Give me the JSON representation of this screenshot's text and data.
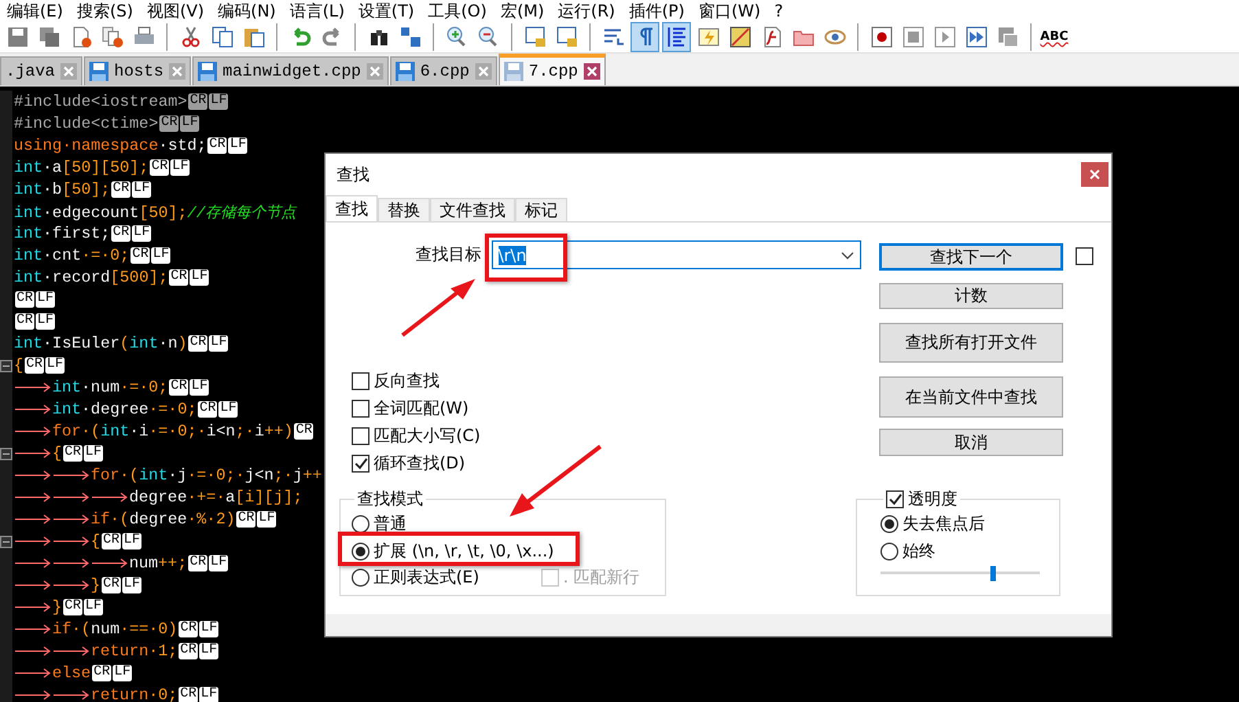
{
  "menu": [
    "编辑(E)",
    "搜索(S)",
    "视图(V)",
    "编码(N)",
    "语言(L)",
    "设置(T)",
    "工具(O)",
    "宏(M)",
    "运行(R)",
    "插件(P)",
    "窗口(W)",
    "?"
  ],
  "toolbar": {
    "buttons": [
      {
        "on": false
      },
      {
        "on": false
      },
      {
        "on": false
      },
      {
        "on": false
      },
      {
        "on": false
      },
      {
        "on": false
      },
      {
        "on": false
      },
      {
        "on": false
      },
      {
        "on": false
      },
      {
        "on": false
      },
      {
        "on": false
      },
      {
        "on": false
      },
      {
        "on": false
      },
      {
        "on": false
      },
      {
        "on": false
      },
      {
        "on": false
      },
      {
        "on": false
      },
      {
        "on": true
      },
      {
        "on": true
      },
      {
        "on": false
      },
      {
        "on": false
      },
      {
        "on": false
      },
      {
        "on": false
      },
      {
        "on": false
      },
      {
        "on": false
      },
      {
        "on": false
      },
      {
        "on": false
      },
      {
        "on": false
      },
      {
        "on": false
      }
    ],
    "spell_label": "ABC"
  },
  "tabs": [
    {
      "label": ".java",
      "icon": false,
      "selected": false
    },
    {
      "label": "hosts",
      "icon": true,
      "selected": false
    },
    {
      "label": "mainwidget.cpp",
      "icon": true,
      "selected": false
    },
    {
      "label": "6.cpp",
      "icon": true,
      "selected": false
    },
    {
      "label": "7.cpp",
      "icon": true,
      "selected": true
    }
  ],
  "editor": {
    "lines": [
      {
        "fold": false,
        "segs": [
          {
            "kind": "pre",
            "text": "#include<iostream>"
          },
          {
            "kind": "eoldim",
            "text": "CR"
          },
          {
            "kind": "eoldim",
            "text": "LF"
          }
        ]
      },
      {
        "fold": false,
        "segs": [
          {
            "kind": "pre",
            "text": "#include<ctime>"
          },
          {
            "kind": "eoldim",
            "text": "CR"
          },
          {
            "kind": "eoldim",
            "text": "LF"
          }
        ]
      },
      {
        "fold": false,
        "segs": [
          {
            "kind": "kw",
            "text": "using·namespace"
          },
          {
            "kind": "id",
            "text": "·std;"
          },
          {
            "kind": "eol",
            "text": "CR"
          },
          {
            "kind": "eol",
            "text": "LF"
          }
        ]
      },
      {
        "fold": false,
        "segs": [
          {
            "kind": "type",
            "text": "int"
          },
          {
            "kind": "id",
            "text": "·a"
          },
          {
            "kind": "op",
            "text": "[50][50];"
          },
          {
            "kind": "eol",
            "text": "CR"
          },
          {
            "kind": "eol",
            "text": "LF"
          }
        ]
      },
      {
        "fold": false,
        "segs": [
          {
            "kind": "type",
            "text": "int"
          },
          {
            "kind": "id",
            "text": "·b"
          },
          {
            "kind": "op",
            "text": "[50];"
          },
          {
            "kind": "eol",
            "text": "CR"
          },
          {
            "kind": "eol",
            "text": "LF"
          }
        ]
      },
      {
        "fold": false,
        "segs": [
          {
            "kind": "type",
            "text": "int"
          },
          {
            "kind": "id",
            "text": "·edgecount"
          },
          {
            "kind": "op",
            "text": "[50];"
          },
          {
            "kind": "cmt",
            "text": "//存储每个节点"
          }
        ]
      },
      {
        "fold": false,
        "segs": [
          {
            "kind": "type",
            "text": "int"
          },
          {
            "kind": "id",
            "text": "·first;"
          },
          {
            "kind": "eol",
            "text": "CR"
          },
          {
            "kind": "eol",
            "text": "LF"
          }
        ]
      },
      {
        "fold": false,
        "segs": [
          {
            "kind": "type",
            "text": "int"
          },
          {
            "kind": "id",
            "text": "·cnt"
          },
          {
            "kind": "op",
            "text": "·=·0;"
          },
          {
            "kind": "eol",
            "text": "CR"
          },
          {
            "kind": "eol",
            "text": "LF"
          }
        ]
      },
      {
        "fold": false,
        "segs": [
          {
            "kind": "type",
            "text": "int"
          },
          {
            "kind": "id",
            "text": "·record"
          },
          {
            "kind": "op",
            "text": "[500];"
          },
          {
            "kind": "eol",
            "text": "CR"
          },
          {
            "kind": "eol",
            "text": "LF"
          }
        ]
      },
      {
        "fold": false,
        "segs": [
          {
            "kind": "eol",
            "text": "CR"
          },
          {
            "kind": "eol",
            "text": "LF"
          }
        ]
      },
      {
        "fold": false,
        "segs": [
          {
            "kind": "eol",
            "text": "CR"
          },
          {
            "kind": "eol",
            "text": "LF"
          }
        ]
      },
      {
        "fold": false,
        "segs": [
          {
            "kind": "type",
            "text": "int"
          },
          {
            "kind": "id",
            "text": "·IsEuler"
          },
          {
            "kind": "op",
            "text": "("
          },
          {
            "kind": "type",
            "text": "int"
          },
          {
            "kind": "id",
            "text": "·n"
          },
          {
            "kind": "op",
            "text": ")"
          },
          {
            "kind": "eol",
            "text": "CR"
          },
          {
            "kind": "eol",
            "text": "LF"
          }
        ]
      },
      {
        "fold": true,
        "segs": [
          {
            "kind": "op",
            "text": "{"
          },
          {
            "kind": "eol",
            "text": "CR"
          },
          {
            "kind": "eol",
            "text": "LF"
          }
        ]
      },
      {
        "fold": false,
        "segs": [
          {
            "kind": "tab"
          },
          {
            "kind": "type",
            "text": "int"
          },
          {
            "kind": "id",
            "text": "·num"
          },
          {
            "kind": "op",
            "text": "·=·0;"
          },
          {
            "kind": "eol",
            "text": "CR"
          },
          {
            "kind": "eol",
            "text": "LF"
          }
        ]
      },
      {
        "fold": false,
        "segs": [
          {
            "kind": "tab"
          },
          {
            "kind": "type",
            "text": "int"
          },
          {
            "kind": "id",
            "text": "·degree"
          },
          {
            "kind": "op",
            "text": "·=·0;"
          },
          {
            "kind": "eol",
            "text": "CR"
          },
          {
            "kind": "eol",
            "text": "LF"
          }
        ]
      },
      {
        "fold": false,
        "segs": [
          {
            "kind": "tab"
          },
          {
            "kind": "kw",
            "text": "for"
          },
          {
            "kind": "op",
            "text": "·("
          },
          {
            "kind": "type",
            "text": "int"
          },
          {
            "kind": "id",
            "text": "·i"
          },
          {
            "kind": "op",
            "text": "·=·0;·"
          },
          {
            "kind": "id",
            "text": "i<n"
          },
          {
            "kind": "op",
            "text": ";·"
          },
          {
            "kind": "id",
            "text": "i"
          },
          {
            "kind": "op",
            "text": "++)"
          },
          {
            "kind": "eol",
            "text": "CR"
          }
        ]
      },
      {
        "fold": true,
        "segs": [
          {
            "kind": "tab"
          },
          {
            "kind": "op",
            "text": "{"
          },
          {
            "kind": "eol",
            "text": "CR"
          },
          {
            "kind": "eol",
            "text": "LF"
          }
        ]
      },
      {
        "fold": false,
        "segs": [
          {
            "kind": "tab"
          },
          {
            "kind": "tab"
          },
          {
            "kind": "kw",
            "text": "for"
          },
          {
            "kind": "op",
            "text": "·("
          },
          {
            "kind": "type",
            "text": "int"
          },
          {
            "kind": "id",
            "text": "·j"
          },
          {
            "kind": "op",
            "text": "·=·0;·"
          },
          {
            "kind": "id",
            "text": "j<n"
          },
          {
            "kind": "op",
            "text": ";·"
          },
          {
            "kind": "id",
            "text": "j"
          },
          {
            "kind": "op",
            "text": "++"
          }
        ]
      },
      {
        "fold": false,
        "segs": [
          {
            "kind": "tab"
          },
          {
            "kind": "tab"
          },
          {
            "kind": "tab"
          },
          {
            "kind": "id",
            "text": "degree"
          },
          {
            "kind": "op",
            "text": "·+=·"
          },
          {
            "kind": "id",
            "text": "a"
          },
          {
            "kind": "op",
            "text": "[i][j];"
          }
        ]
      },
      {
        "fold": false,
        "segs": [
          {
            "kind": "tab"
          },
          {
            "kind": "tab"
          },
          {
            "kind": "kw",
            "text": "if"
          },
          {
            "kind": "op",
            "text": "·("
          },
          {
            "kind": "id",
            "text": "degree"
          },
          {
            "kind": "op",
            "text": "·%·2)"
          },
          {
            "kind": "eol",
            "text": "CR"
          },
          {
            "kind": "eol",
            "text": "LF"
          }
        ]
      },
      {
        "fold": true,
        "segs": [
          {
            "kind": "tab"
          },
          {
            "kind": "tab"
          },
          {
            "kind": "op",
            "text": "{"
          },
          {
            "kind": "eol",
            "text": "CR"
          },
          {
            "kind": "eol",
            "text": "LF"
          }
        ]
      },
      {
        "fold": false,
        "segs": [
          {
            "kind": "tab"
          },
          {
            "kind": "tab"
          },
          {
            "kind": "tab"
          },
          {
            "kind": "id",
            "text": "num"
          },
          {
            "kind": "op",
            "text": "++;"
          },
          {
            "kind": "eol",
            "text": "CR"
          },
          {
            "kind": "eol",
            "text": "LF"
          }
        ]
      },
      {
        "fold": false,
        "segs": [
          {
            "kind": "tab"
          },
          {
            "kind": "tab"
          },
          {
            "kind": "op",
            "text": "}"
          },
          {
            "kind": "eol",
            "text": "CR"
          },
          {
            "kind": "eol",
            "text": "LF"
          }
        ]
      },
      {
        "fold": false,
        "segs": [
          {
            "kind": "tab"
          },
          {
            "kind": "op",
            "text": "}"
          },
          {
            "kind": "eol",
            "text": "CR"
          },
          {
            "kind": "eol",
            "text": "LF"
          }
        ]
      },
      {
        "fold": false,
        "segs": [
          {
            "kind": "tab"
          },
          {
            "kind": "kw",
            "text": "if"
          },
          {
            "kind": "op",
            "text": "·("
          },
          {
            "kind": "id",
            "text": "num"
          },
          {
            "kind": "op",
            "text": "·==·0)"
          },
          {
            "kind": "eol",
            "text": "CR"
          },
          {
            "kind": "eol",
            "text": "LF"
          }
        ]
      },
      {
        "fold": false,
        "segs": [
          {
            "kind": "tab"
          },
          {
            "kind": "tab"
          },
          {
            "kind": "kw",
            "text": "return"
          },
          {
            "kind": "op",
            "text": "·1;"
          },
          {
            "kind": "eol",
            "text": "CR"
          },
          {
            "kind": "eol",
            "text": "LF"
          }
        ]
      },
      {
        "fold": false,
        "segs": [
          {
            "kind": "tab"
          },
          {
            "kind": "kw",
            "text": "else"
          },
          {
            "kind": "eol",
            "text": "CR"
          },
          {
            "kind": "eol",
            "text": "LF"
          }
        ]
      },
      {
        "fold": false,
        "segs": [
          {
            "kind": "tab"
          },
          {
            "kind": "tab"
          },
          {
            "kind": "kw",
            "text": "return"
          },
          {
            "kind": "op",
            "text": "·0;"
          },
          {
            "kind": "eol",
            "text": "CR"
          },
          {
            "kind": "eol",
            "text": "LF"
          }
        ]
      }
    ]
  },
  "find_dialog": {
    "title": "查找",
    "tabs": [
      {
        "label": "查找",
        "selected": true
      },
      {
        "label": "替换",
        "selected": false
      },
      {
        "label": "文件查找",
        "selected": false
      },
      {
        "label": "标记",
        "selected": false
      }
    ],
    "search": {
      "label": "查找目标",
      "value": "\\r\\n",
      "text_selected": true
    },
    "buttons": [
      {
        "label": "查找下一个",
        "default": true
      },
      {
        "label": "计数",
        "default": false
      },
      {
        "label": "查找所有打开文件",
        "default": false
      },
      {
        "label": "在当前文件中查找",
        "default": false
      },
      {
        "label": "取消",
        "default": false
      }
    ],
    "side_checkbox": {
      "checked": false
    },
    "options": [
      {
        "label": "反向查找",
        "checked": false
      },
      {
        "label": "全词匹配(W)",
        "checked": false
      },
      {
        "label": "匹配大小写(C)",
        "checked": false
      },
      {
        "label": "循环查找(D)",
        "checked": true
      }
    ],
    "search_mode": {
      "title": "查找模式",
      "modes": [
        {
          "label": "普通",
          "selected": false
        },
        {
          "label": "扩展 (\\n, \\r, \\t, \\0, \\x...)",
          "selected": true
        },
        {
          "label": "正则表达式(E)",
          "selected": false
        }
      ],
      "dot_newline": {
        "label": ". 匹配新行",
        "checked": false,
        "disabled": true
      }
    },
    "transparency": {
      "label": "透明度",
      "checked": true,
      "modes": [
        {
          "label": "失去焦点后",
          "selected": true
        },
        {
          "label": "始终",
          "selected": false
        }
      ],
      "level": 0.71
    }
  }
}
